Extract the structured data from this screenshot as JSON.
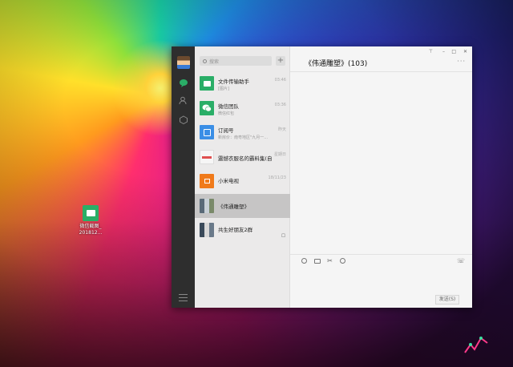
{
  "desktop": {
    "icon_label_line1": "微信截图_",
    "icon_label_line2": "20181‌2..."
  },
  "window": {
    "controls": {
      "pin": "⊤",
      "minimize": "–",
      "maximize": "□",
      "close": "✕"
    },
    "search": {
      "placeholder": "搜索"
    },
    "add_label": "+",
    "chats": [
      {
        "name": "文件传输助手",
        "preview": "[图片]",
        "time": "03:46",
        "icon": "file-transfer-icon",
        "color": "#2aae67"
      },
      {
        "name": "微信团队",
        "preview": "微信红包",
        "time": "03:36",
        "icon": "wechat-team-icon",
        "color": "#2aae67"
      },
      {
        "name": "订阅号",
        "preview": "新房价：南粤地区\"九月一...",
        "time": "昨天",
        "icon": "subscription-icon",
        "color": "#3a8ee6"
      },
      {
        "name": "震憾衣服名的霸料集(自",
        "preview": "",
        "time": "星期日",
        "icon": "ad-thumbnail-icon",
        "color": "#f3f3f3"
      },
      {
        "name": "小米电视",
        "preview": "",
        "time": "18/11/23",
        "icon": "mi-tv-icon",
        "color": "#f07a1a"
      },
      {
        "name": "《伟通雕塑》",
        "preview": "",
        "time": "",
        "icon": "group-avatar-icon",
        "color": "#8a9aa8"
      },
      {
        "name": "共生好朋友2群",
        "preview": "",
        "time": "",
        "icon": "group-avatar-icon",
        "color": "#8a9aa8"
      }
    ],
    "main": {
      "title": "《伟通雕塑》(103)",
      "more": "···",
      "send_label": "发送(S)"
    }
  }
}
